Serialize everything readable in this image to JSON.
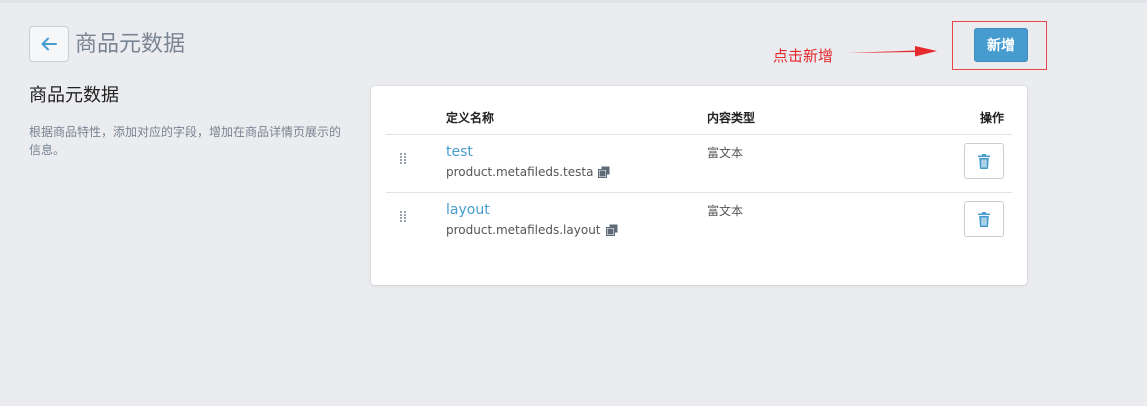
{
  "header": {
    "title": "商品元数据",
    "back_icon": "arrow-left-icon"
  },
  "annotation": {
    "text": "点击新增",
    "color": "#e5292d"
  },
  "toolbar": {
    "add_label": "新增"
  },
  "section": {
    "heading": "商品元数据",
    "description": "根据商品特性，添加对应的字段，增加在商品详情页展示的信息。"
  },
  "table": {
    "columns": {
      "name": "定义名称",
      "type": "内容类型",
      "ops": "操作"
    },
    "rows": [
      {
        "name": "test",
        "key": "product.metafileds.testa",
        "type": "富文本"
      },
      {
        "name": "layout",
        "key": "product.metafileds.layout",
        "type": "富文本"
      }
    ]
  },
  "colors": {
    "accent": "#479ccf",
    "background": "#eaecef",
    "annotation": "#e5292d"
  }
}
